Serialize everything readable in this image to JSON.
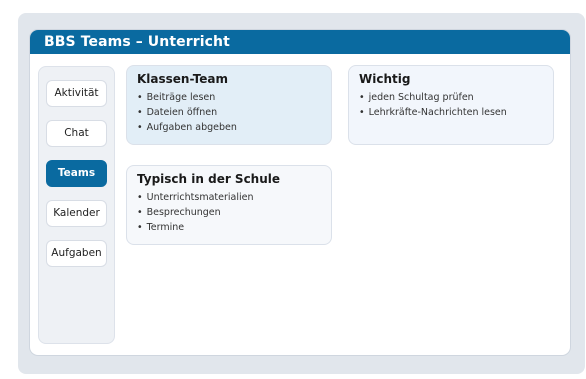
{
  "window": {
    "title": "BBS Teams – Unterricht",
    "accent_color": "#0a6aa0"
  },
  "sidebar": {
    "items": [
      {
        "label": "Aktivität",
        "active": false
      },
      {
        "label": "Chat",
        "active": false
      },
      {
        "label": "Teams",
        "active": true
      },
      {
        "label": "Kalender",
        "active": false
      },
      {
        "label": "Aufgaben",
        "active": false
      }
    ]
  },
  "cards": {
    "klassen": {
      "title": "Klassen-Team",
      "items": [
        "Beiträge lesen",
        "Dateien öffnen",
        "Aufgaben abgeben"
      ]
    },
    "wichtig": {
      "title": "Wichtig",
      "items": [
        "jeden Schultag prüfen",
        "Lehrkräfte-Nachrichten lesen"
      ]
    },
    "typisch": {
      "title": "Typisch in der Schule",
      "items": [
        "Unterrichtsmaterialien",
        "Besprechungen",
        "Termine"
      ]
    }
  }
}
